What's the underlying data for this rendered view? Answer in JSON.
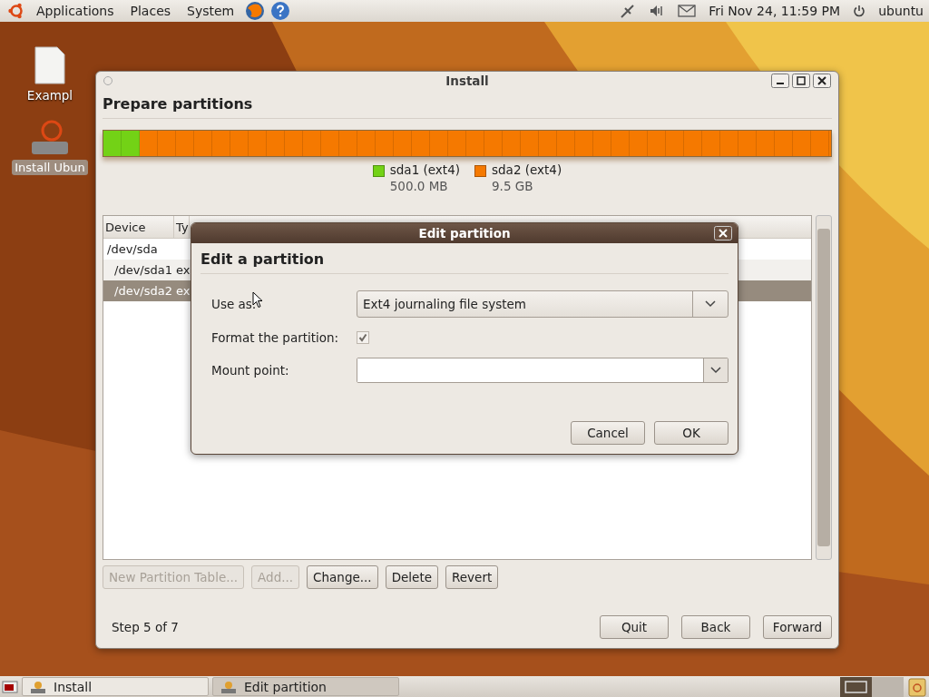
{
  "top_panel": {
    "menus": [
      "Applications",
      "Places",
      "System"
    ],
    "clock": "Fri Nov 24, 11:59 PM",
    "user": "ubuntu"
  },
  "desktop_icons": [
    {
      "label": "Exampl",
      "kind": "file"
    },
    {
      "label": "Install Ubun",
      "kind": "installer"
    }
  ],
  "install_window": {
    "title": "Install",
    "heading": "Prepare partitions",
    "partitions": [
      {
        "label": "sda1 (ext4)",
        "size": "500.0 MB",
        "color": "#73d216",
        "level": 0.05
      },
      {
        "label": "sda2 (ext4)",
        "size": "9.5 GB",
        "color": "#f57900",
        "level": 0.95
      }
    ],
    "table": {
      "columns": [
        "Device",
        "Ty"
      ],
      "rows": [
        {
          "cells": [
            "/dev/sda"
          ],
          "selected": false,
          "children": [
            {
              "cells": [
                "/dev/sda1",
                "ex"
              ],
              "selected": false
            },
            {
              "cells": [
                "/dev/sda2",
                "ex"
              ],
              "selected": true
            }
          ]
        }
      ]
    },
    "actions": [
      {
        "label": "New Partition Table...",
        "disabled": true
      },
      {
        "label": "Add...",
        "disabled": true
      },
      {
        "label": "Change...",
        "disabled": false
      },
      {
        "label": "Delete",
        "disabled": false
      },
      {
        "label": "Revert",
        "disabled": false
      }
    ],
    "step": "Step 5 of 7",
    "buttons": [
      "Quit",
      "Back",
      "Forward"
    ]
  },
  "dialog": {
    "title": "Edit partition",
    "heading": "Edit a partition",
    "use_as": {
      "label": "Use as:",
      "value": "Ext4 journaling file system"
    },
    "format": {
      "label": "Format the partition:",
      "checked": true,
      "disabled": true
    },
    "mount": {
      "label": "Mount point:"
    },
    "buttons": [
      "Cancel",
      "OK"
    ]
  },
  "taskbar": [
    {
      "label": "Install",
      "selected": false
    },
    {
      "label": "Edit partition",
      "selected": true
    }
  ]
}
